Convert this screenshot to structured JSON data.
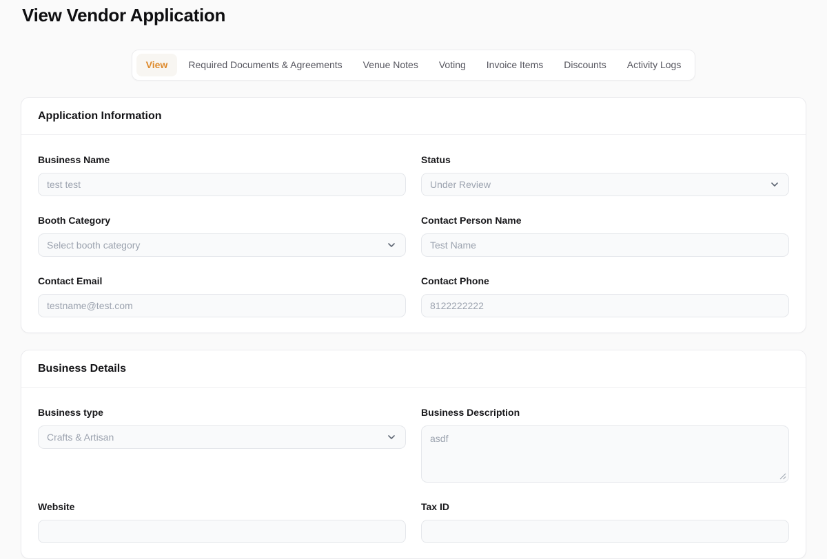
{
  "page": {
    "title": "View Vendor Application"
  },
  "colors": {
    "accent_orange": "#de8a2b",
    "page_background": "#fafafa",
    "input_text_gray": "#9ca3af"
  },
  "tabs": [
    {
      "label": "View",
      "active": true
    },
    {
      "label": "Required Documents & Agreements",
      "active": false
    },
    {
      "label": "Venue Notes",
      "active": false
    },
    {
      "label": "Voting",
      "active": false
    },
    {
      "label": "Invoice Items",
      "active": false
    },
    {
      "label": "Discounts",
      "active": false
    },
    {
      "label": "Activity Logs",
      "active": false
    }
  ],
  "application_information": {
    "title": "Application Information",
    "business_name": {
      "label": "Business Name",
      "value": "test test"
    },
    "status": {
      "label": "Status",
      "value": "Under Review"
    },
    "booth_category": {
      "label": "Booth Category",
      "value": "Select booth category"
    },
    "contact_person_name": {
      "label": "Contact Person Name",
      "value": "Test Name"
    },
    "contact_email": {
      "label": "Contact Email",
      "value": "testname@test.com"
    },
    "contact_phone": {
      "label": "Contact Phone",
      "value": "8122222222"
    }
  },
  "business_details": {
    "title": "Business Details",
    "business_type": {
      "label": "Business type",
      "value": "Crafts & Artisan"
    },
    "business_description": {
      "label": "Business Description",
      "value": "asdf"
    },
    "website": {
      "label": "Website"
    },
    "tax_id": {
      "label": "Tax ID"
    }
  }
}
